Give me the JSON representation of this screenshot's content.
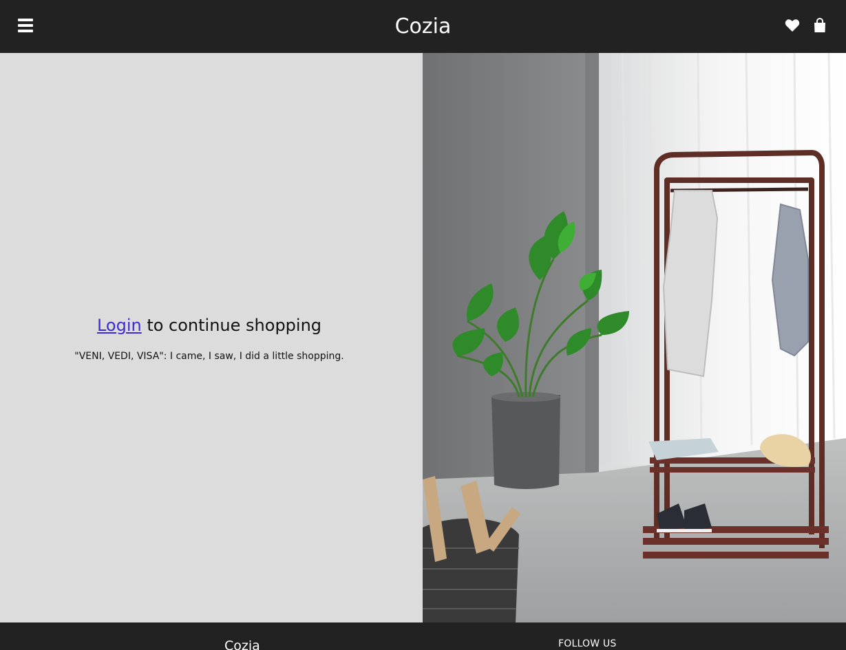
{
  "header": {
    "brand": "Cozia",
    "menu_icon": "hamburger-menu-icon",
    "wishlist_icon": "heart-icon",
    "cart_icon": "shopping-bag-icon"
  },
  "main": {
    "login_link": "Login",
    "login_suffix": " to continue shopping",
    "quote": "\"VENI, VEDI, VISA\": I came, I saw, I did a little shopping."
  },
  "footer": {
    "brand": "Cozia",
    "follow_heading": "FOLLOW US"
  },
  "colors": {
    "header_bg": "#222222",
    "panel_bg": "#dddcdd",
    "link": "#3b2bd6"
  }
}
